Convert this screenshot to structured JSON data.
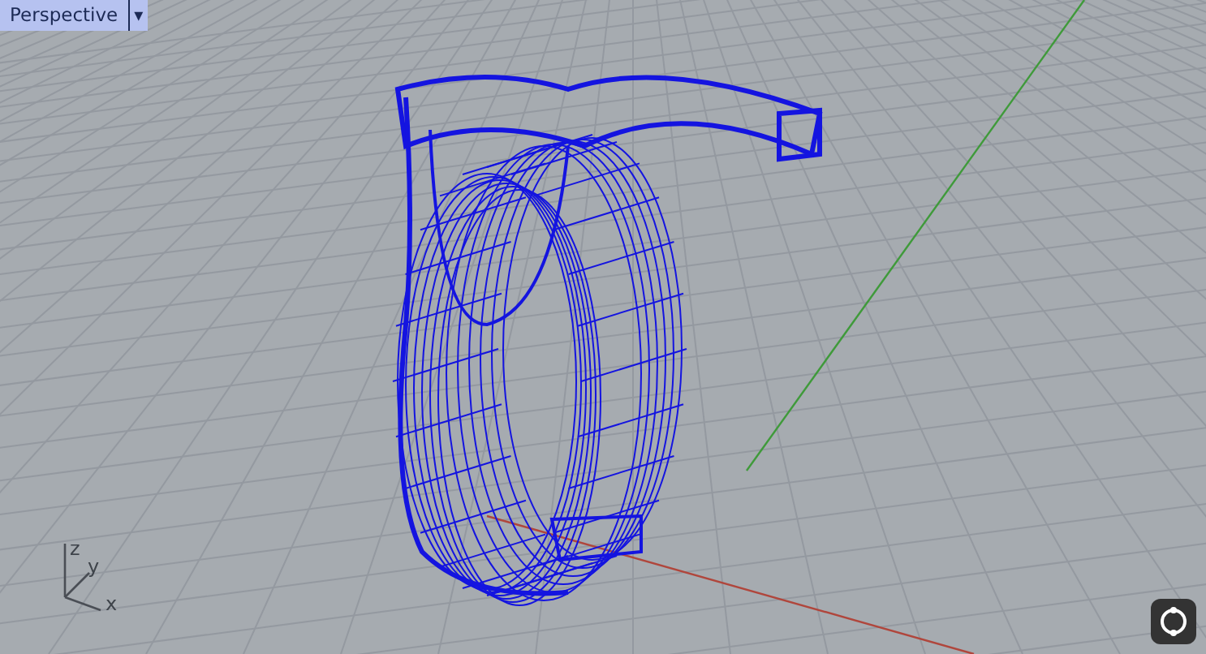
{
  "viewport": {
    "title": "Perspective",
    "dropdown": "▾"
  },
  "gizmo": {
    "axes": [
      {
        "kind": "z",
        "label": "z"
      },
      {
        "kind": "y",
        "label": "y"
      },
      {
        "kind": "x",
        "label": "x"
      }
    ]
  }
}
